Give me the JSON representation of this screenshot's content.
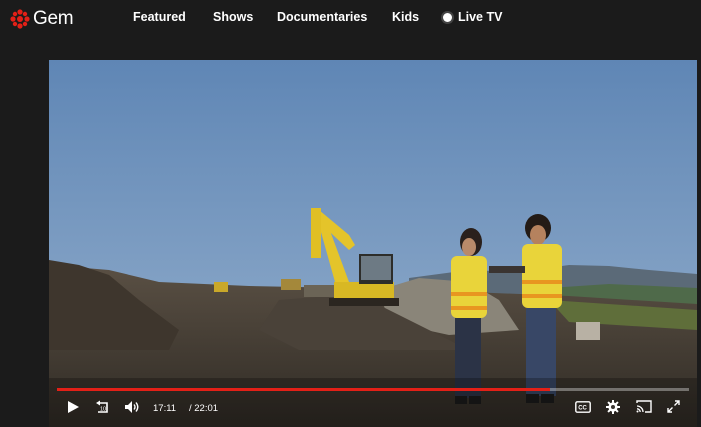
{
  "brand": {
    "name": "Gem",
    "logo_icon": "cbc-gem-icon",
    "color": "#e32017"
  },
  "nav": {
    "featured": "Featured",
    "shows": "Shows",
    "documentaries": "Documentaries",
    "kids": "Kids",
    "live_tv": "Live TV"
  },
  "player": {
    "current_time": "17:11",
    "duration": "/ 22:01",
    "progress_fraction": 0.78,
    "accent": "#e32017",
    "controls": [
      "play-icon",
      "replay-10-icon",
      "volume-icon",
      "captions-icon",
      "settings-icon",
      "cast-icon",
      "fullscreen-icon"
    ]
  }
}
